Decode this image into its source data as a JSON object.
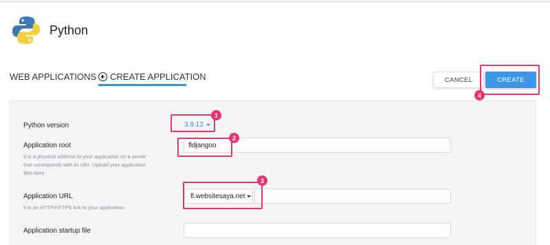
{
  "app": {
    "title": "Python"
  },
  "tabs": [
    {
      "label": "WEB APPLICATIONS"
    },
    {
      "label": "CREATE APPLICATION"
    }
  ],
  "actions": {
    "cancel_label": "CANCEL",
    "create_label": "CREATE"
  },
  "form": {
    "python_version": {
      "label": "Python version",
      "value": "3.9.12"
    },
    "app_root": {
      "label": "Application root",
      "value": "fldjangoo",
      "help": "It is a physical address to your application on a server that corresponds with its URI. Upload your application files here."
    },
    "app_url": {
      "label": "Application URL",
      "domain": "fl.websitesaya.net",
      "help": "It is an HTTP/HTTPS link to your application"
    },
    "startup_file": {
      "label": "Application startup file",
      "value": ""
    }
  },
  "annotations": [
    "1",
    "2",
    "3",
    "4"
  ],
  "colors": {
    "accent": "#3a8fd6",
    "highlight": "#e8336b",
    "primary_button": "#3d97e8"
  }
}
